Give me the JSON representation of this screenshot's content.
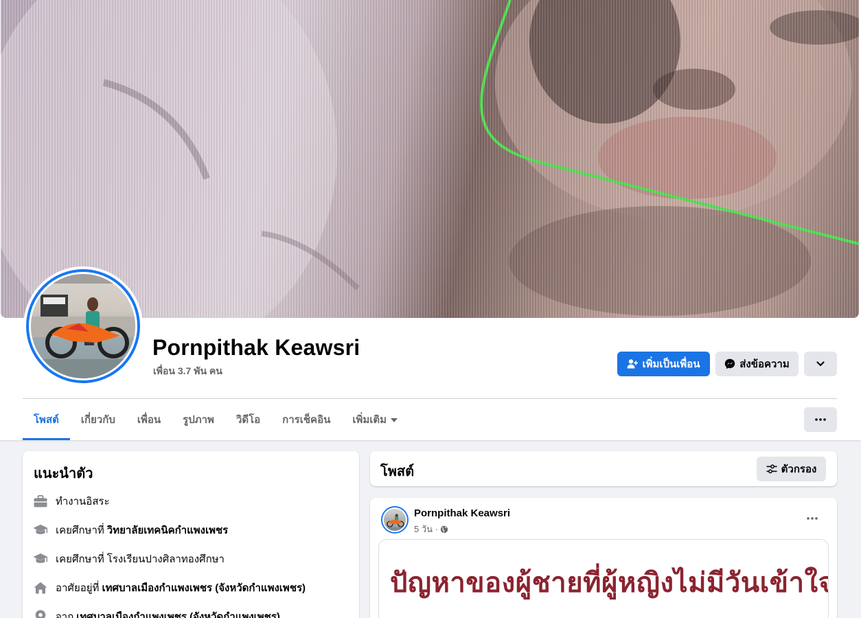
{
  "profile": {
    "name": "Pornpithak Keawsri",
    "friend_count": "เพื่อน 3.7 พัน คน"
  },
  "actions": {
    "add_friend": "เพิ่มเป็นเพื่อน",
    "message": "ส่งข้อความ"
  },
  "tabs": [
    {
      "label": "โพสต์",
      "active": true
    },
    {
      "label": "เกี่ยวกับ",
      "active": false
    },
    {
      "label": "เพื่อน",
      "active": false
    },
    {
      "label": "รูปภาพ",
      "active": false
    },
    {
      "label": "วิดีโอ",
      "active": false
    },
    {
      "label": "การเช็คอิน",
      "active": false
    },
    {
      "label": "เพิ่มเติม",
      "active": false
    }
  ],
  "intro": {
    "title": "แนะนำตัว",
    "items": [
      {
        "icon": "briefcase-icon",
        "text": "ทำงานอิสระ",
        "bold": ""
      },
      {
        "icon": "graduation-cap-icon",
        "text": "เคยศึกษาที่",
        "bold": "วิทยาลัยเทคนิคกำแพงเพชร"
      },
      {
        "icon": "graduation-cap-icon",
        "text": "เคยศึกษาที่",
        "bold": "โรงเรียนปางศิลาทองศึกษา"
      },
      {
        "icon": "home-icon",
        "text": "อาศัยอยู่ที่",
        "bold": "เทศบาลเมืองกำแพงเพชร (จังหวัดกำแพงเพชร)"
      },
      {
        "icon": "location-pin-icon",
        "text": "จาก",
        "bold": "เทศบาลเมืองกำแพงเพชร (จังหวัดกำแพงเพชร)"
      }
    ]
  },
  "posts": {
    "title": "โพสต์",
    "filter_label": "ตัวกรอง"
  },
  "post": {
    "author": "Pornpithak Keawsri",
    "time": "5 วัน ·",
    "privacy_icon": "globe-icon",
    "image_text": "ปัญหาของผู้ชายที่ผู้หญิงไม่มีวันเข้าใจ"
  },
  "avatar_caption": "Pornpithak",
  "colors": {
    "accent": "#1b74e4",
    "secondary_button": "#e4e6eb",
    "muted_text": "#65676b",
    "post_text": "#8c2330"
  }
}
